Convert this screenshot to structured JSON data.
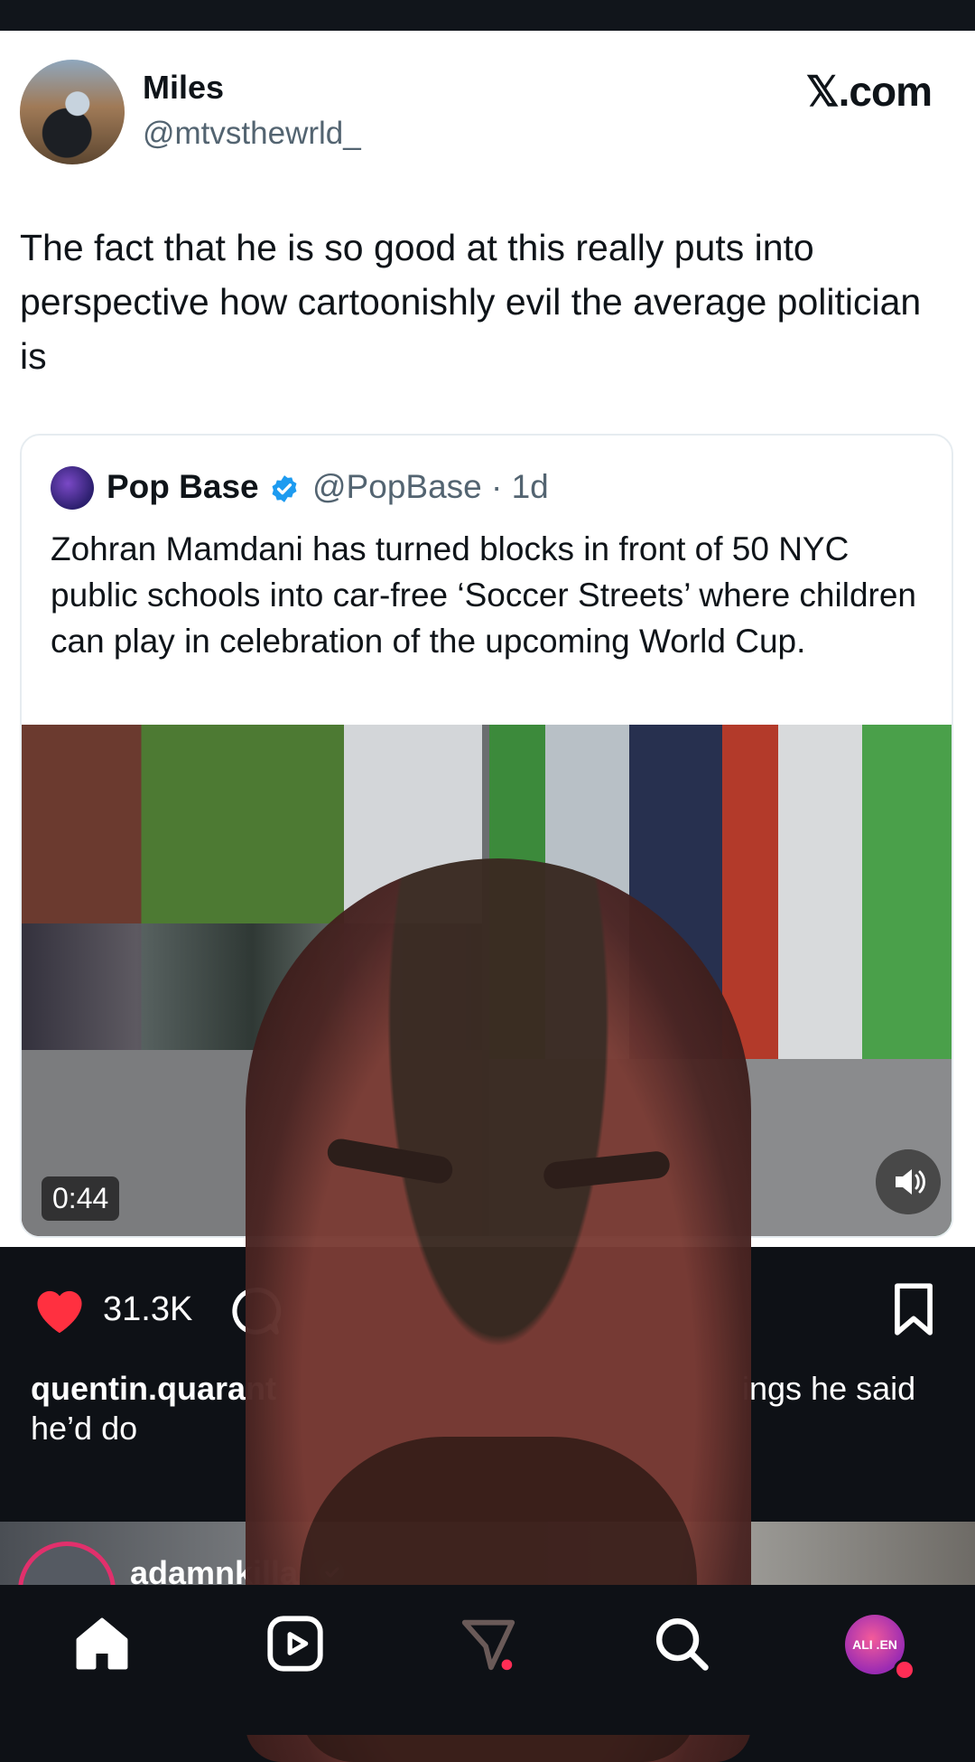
{
  "tweet": {
    "display_name": "Miles",
    "handle": "@mtvsthewrld_",
    "site": "𝕏.com",
    "text": "The fact that he is so good at this really puts into perspective how cartoonishly evil the average politician is"
  },
  "quoted": {
    "display_name": "Pop Base",
    "handle_and_time": "@PopBase · 1d",
    "text": "Zohran Mamdani has turned blocks in front of 50 NYC public schools into car-free ‘Soccer Streets’ where children can play in celebration of the upcoming World Cup.",
    "video_duration": "0:44"
  },
  "post": {
    "like_count": "31.3K",
    "caption_user": "quentin.quarant",
    "caption_tail": "ings he said",
    "caption_line2": "he’d do"
  },
  "next_post": {
    "username": "adamnkilla"
  },
  "profile": {
    "avatar_text": "ALI .EN"
  },
  "icons": {
    "like": "heart-icon",
    "comment": "comment-icon",
    "bookmark": "bookmark-icon",
    "verified": "verified-badge-icon",
    "sound": "speaker-icon",
    "home": "home-icon",
    "reels": "reels-icon",
    "send": "send-icon",
    "search": "search-icon"
  },
  "colors": {
    "like_red": "#ff3040",
    "verified_blue": "#1d9bf0",
    "notification_red": "#ff2d55",
    "story_ring": "#e1306c"
  }
}
